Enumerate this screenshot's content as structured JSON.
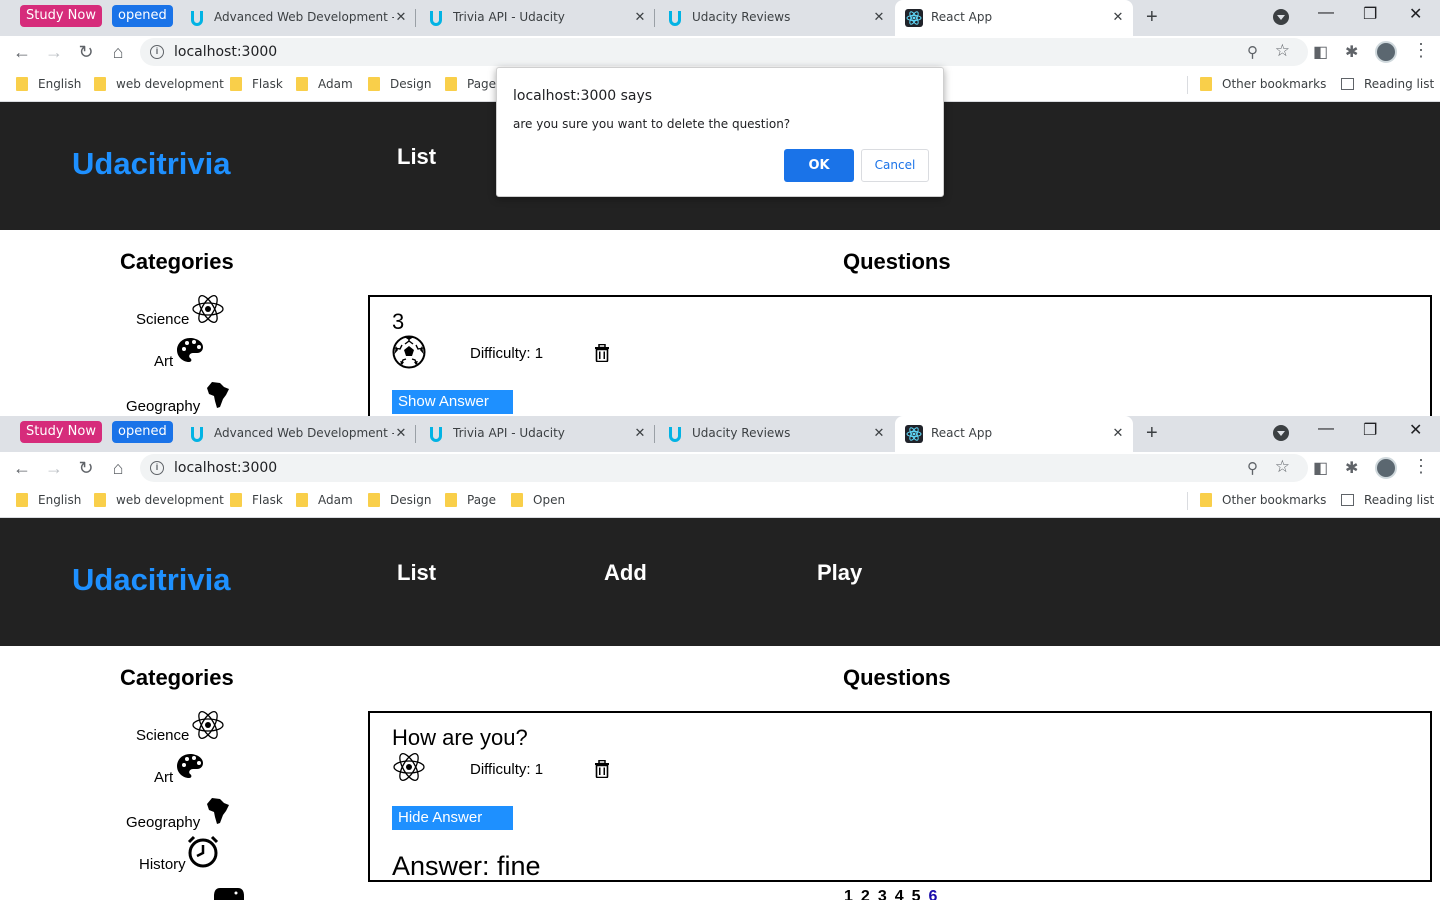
{
  "browser": {
    "extension_badges": {
      "study": "Study Now",
      "opened": "opened"
    },
    "tabs": [
      {
        "title": "Advanced Web Development - U",
        "close": "✕"
      },
      {
        "title": "Trivia API - Udacity",
        "close": "✕"
      },
      {
        "title": "Udacity Reviews",
        "close": "✕"
      },
      {
        "title": "React App",
        "close": "✕"
      }
    ],
    "new_tab": "+",
    "window_controls": {
      "minimize": "—",
      "maximize": "❐",
      "close": "✕"
    },
    "url": "localhost:3000",
    "bookmarks_top": [
      "English",
      "web development",
      "Flask",
      "Adam",
      "Design",
      "Page"
    ],
    "bookmarks_bottom": [
      "English",
      "web development",
      "Flask",
      "Adam",
      "Design",
      "Page",
      "Open"
    ],
    "other_bookmarks": "Other bookmarks",
    "reading_list": "Reading list"
  },
  "app": {
    "brand": "Udacitrivia",
    "nav": {
      "list": "List",
      "add": "Add",
      "play": "Play"
    },
    "categories_heading": "Categories",
    "questions_heading": "Questions",
    "categories": [
      "Science",
      "Art",
      "Geography",
      "History"
    ]
  },
  "top_view": {
    "question": "3",
    "category_icon": "soccer-ball-icon",
    "difficulty": "Difficulty: 1",
    "answer_button": "Show Answer"
  },
  "bottom_view": {
    "question": "How are you?",
    "category_icon": "atom-icon",
    "difficulty": "Difficulty: 1",
    "answer_button": "Hide Answer",
    "answer": "Answer: fine",
    "pages": [
      "1",
      "2",
      "3",
      "4",
      "5",
      "6"
    ],
    "current_page": "6"
  },
  "dialog": {
    "title": "localhost:3000 says",
    "message": "are you sure you want to delete the question?",
    "ok": "OK",
    "cancel": "Cancel"
  },
  "colors": {
    "brand": "#1e90ff",
    "appbar": "#222222",
    "dialog_primary": "#1a73e8"
  }
}
